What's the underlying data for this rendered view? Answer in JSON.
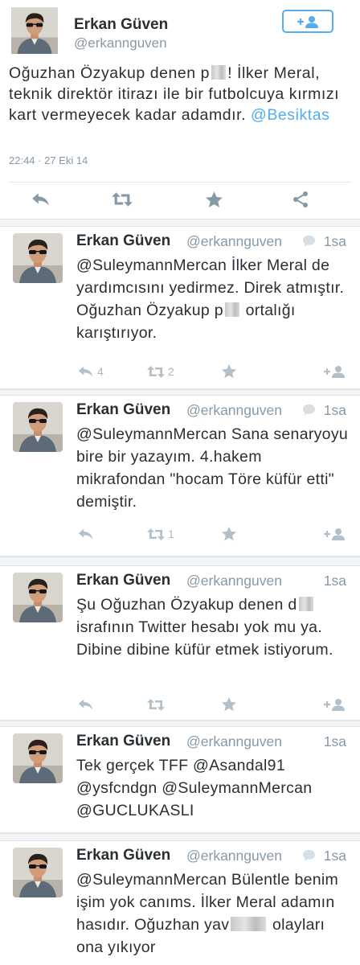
{
  "main_tweet": {
    "author_name": "Erkan Güven",
    "author_handle": "@erkannguven",
    "follow_icon": "follow-user-icon",
    "text_before": "Oğuzhan Özyakup denen p",
    "text_after": "! İlker Meral, teknik direktör itirazı ile bir futbolcuya kırmızı kart vermeyecek kadar adamdır.",
    "mention": "@Besiktas",
    "timestamp": "22:44 · 27 Eki 14",
    "actions": [
      "reply-icon",
      "retweet-icon",
      "favorite-icon",
      "share-icon"
    ]
  },
  "tweets": [
    {
      "name": "Erkan Güven",
      "handle": "@erkannguven",
      "time": "1sa",
      "has_conversation": true,
      "text_before": "@SuleymannMercan İlker Meral de yardımcısını yedirmez. Direk atmıştır. Oğuzhan Özyakup p",
      "text_after": " ortalığı karıştırıyor.",
      "reply_count": "4",
      "retweet_count": "2"
    },
    {
      "name": "Erkan Güven",
      "handle": "@erkannguven",
      "time": "1sa",
      "has_conversation": true,
      "text": "@SuleymannMercan Sana senaryoyu bire bir yazayım. 4.hakem mikrafondan \"hocam Töre küfür etti\" demiştir.",
      "reply_count": "",
      "retweet_count": "1"
    },
    {
      "name": "Erkan Güven",
      "handle": "@erkannguven",
      "time": "1sa",
      "has_conversation": false,
      "text_before": "Şu Oğuzhan Özyakup denen d",
      "text_after": " israfının Twitter hesabı yok mu ya. Dibine dibine küfür etmek istiyorum.",
      "reply_count": "",
      "retweet_count": ""
    },
    {
      "name": "Erkan Güven",
      "handle": "@erkannguven",
      "time": "1sa",
      "has_conversation": false,
      "text": "Tek gerçek TFF @Asandal91 @ysfcndgn @SuleymannMercan @GUCLUKASLI",
      "reply_count": "",
      "retweet_count": ""
    },
    {
      "name": "Erkan Güven",
      "handle": "@erkannguven",
      "time": "1sa",
      "has_conversation": true,
      "text_before": "@SuleymannMercan Bülentle benim işim yok canıms. İlker Meral adamın hasıdır. Oğuzhan yav",
      "text_after": " olayları ona yıkıyor",
      "reply_count": "",
      "retweet_count": ""
    }
  ],
  "colors": {
    "accent": "#55acee",
    "text": "#292f33",
    "muted": "#8899a6",
    "action_icons": "#a8b6c0",
    "separator": "#f2f4f5"
  }
}
